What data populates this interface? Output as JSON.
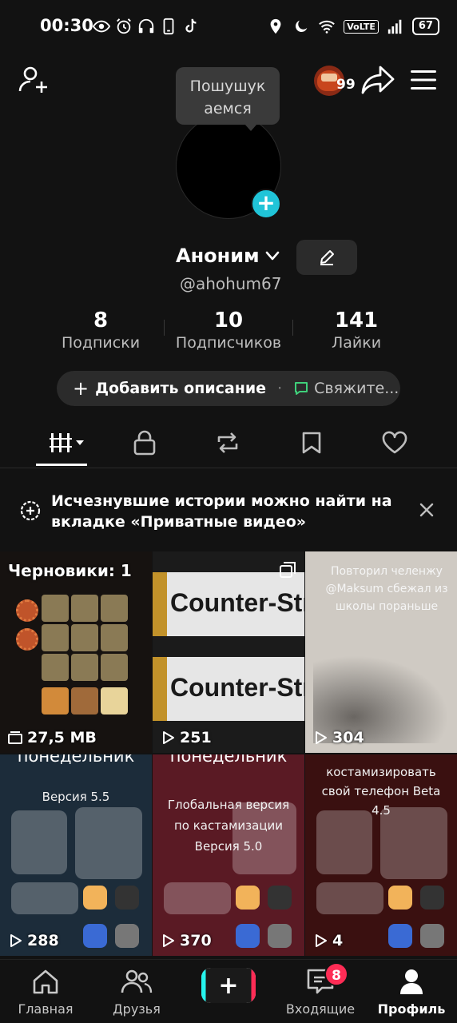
{
  "status_bar": {
    "time": "00:30",
    "volte": "VoLTE",
    "battery": "67"
  },
  "header": {
    "notification_count": "99"
  },
  "tooltip": {
    "line1": "Пошушук",
    "line2": "аемся"
  },
  "profile": {
    "name": "Аноним",
    "username": "@ahohum67",
    "stats": [
      {
        "value": "8",
        "label": "Подписки"
      },
      {
        "value": "10",
        "label": "Подписчиков"
      },
      {
        "value": "141",
        "label": "Лайки"
      }
    ],
    "add_description": "Добавить описание",
    "contact": "Свяжите..."
  },
  "notice": {
    "text": "Исчезнувшие истории можно найти на вкладке «Приватные видео»"
  },
  "grid": {
    "drafts": {
      "title": "Черновики: 1",
      "size": "27,5 MB"
    },
    "videos": [
      {
        "views": "251",
        "overlay": "Counter-Str"
      },
      {
        "views": "304",
        "overlay": "Повторил челенжу @Maksum сбежал из школы пораньше"
      },
      {
        "views": "288",
        "overlay": "понедельник",
        "sub": "Версия 5.5"
      },
      {
        "views": "370",
        "overlay": "понедельник",
        "sub": "Глобальная версия по кастамизации Версия 5.0"
      },
      {
        "views": "4",
        "overlay": "костамизировать свой телефон Beta 4.5"
      }
    ]
  },
  "nav": {
    "home": "Главная",
    "friends": "Друзья",
    "inbox": "Входящие",
    "inbox_badge": "8",
    "profile": "Профиль"
  },
  "colors": {
    "background": "#121212",
    "accent_cyan": "#25f4ee",
    "accent_red": "#fe2c55",
    "plus_button": "#20c4d8",
    "pill": "#2b2b2b"
  }
}
